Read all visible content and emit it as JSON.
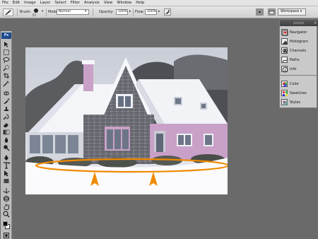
{
  "menu": [
    "File",
    "Edit",
    "Image",
    "Layer",
    "Select",
    "Filter",
    "Analysis",
    "View",
    "Window",
    "Help"
  ],
  "options_bar": {
    "brush_label": "Brush:",
    "brush_size": "57",
    "mode_label": "Mode:",
    "mode_value": "Normal",
    "opacity_label": "Opacity:",
    "opacity_value": "100%",
    "flow_label": "Flow:",
    "flow_value": "100%",
    "workspace_label": "Workspace"
  },
  "tools_panel": {
    "logo": "Ps",
    "tools": [
      "move-tool",
      "marquee-tool",
      "lasso-tool",
      "quick-select-tool",
      "crop-tool",
      "eyedropper-tool",
      "healing-brush-tool",
      "brush-tool",
      "clone-stamp-tool",
      "history-brush-tool",
      "eraser-tool",
      "gradient-tool",
      "blur-tool",
      "dodge-tool",
      "pen-tool",
      "type-tool",
      "path-select-tool",
      "shape-tool",
      "3d-rotate-tool",
      "3d-orbit-tool",
      "hand-tool",
      "zoom-tool"
    ],
    "foreground_color": "#000000",
    "background_color": "#ffffff"
  },
  "panels": {
    "group1": [
      {
        "label": "Navigator",
        "icon": "navigator-icon"
      },
      {
        "label": "Histogram",
        "icon": "histogram-icon"
      },
      {
        "label": "Channels",
        "icon": "channels-icon"
      },
      {
        "label": "Paths",
        "icon": "paths-icon"
      },
      {
        "label": "Info",
        "icon": "info-icon"
      }
    ],
    "group2": [
      {
        "label": "Color",
        "icon": "color-icon"
      },
      {
        "label": "Swatches",
        "icon": "swatches-icon"
      },
      {
        "label": "Styles",
        "icon": "styles-icon"
      }
    ]
  },
  "colors": {
    "app_background": "#6a6a6a",
    "annotation_orange": "#f08a00",
    "cottage_pink": "#c9a0c8"
  }
}
